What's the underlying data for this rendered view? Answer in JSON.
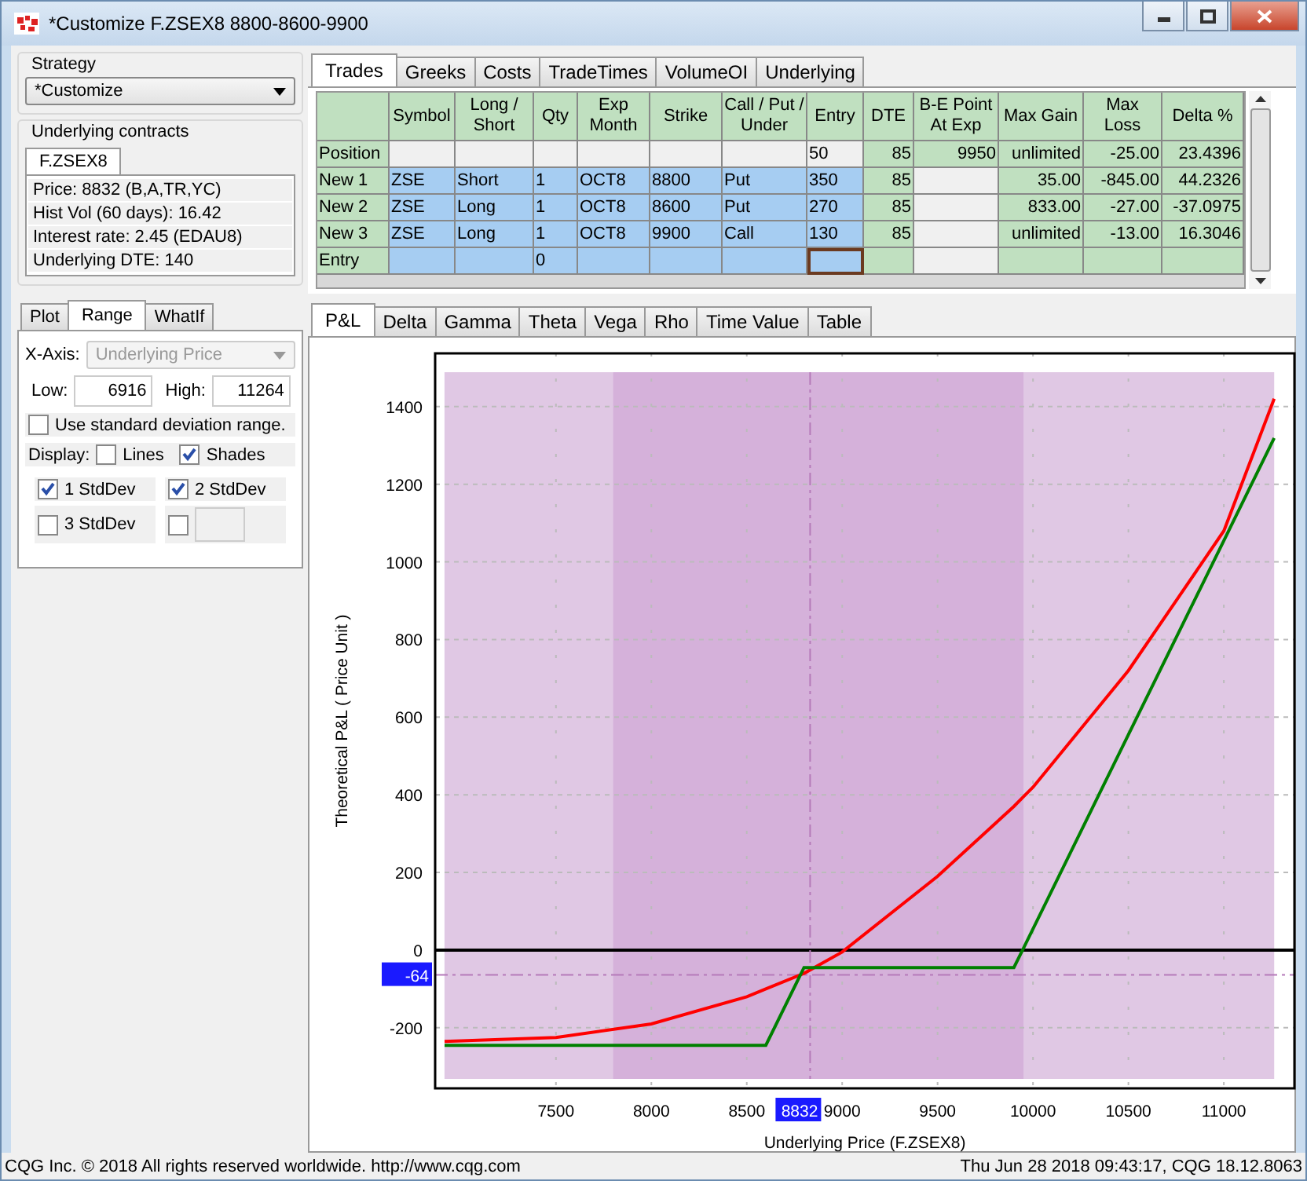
{
  "window": {
    "title": "*Customize F.ZSEX8 8800-8600-9900"
  },
  "strategy": {
    "label": "Strategy",
    "value": "*Customize"
  },
  "underlying": {
    "label": "Underlying contracts",
    "tab": "F.ZSEX8",
    "lines": [
      "Price: 8832 (B,A,TR,YC)",
      "Hist Vol (60 days): 16.42",
      "Interest rate: 2.45 (EDAU8)",
      "Underlying DTE: 140"
    ]
  },
  "settings_tabs": [
    {
      "label": "Plot",
      "selected": false
    },
    {
      "label": "Range",
      "selected": true
    },
    {
      "label": "WhatIf",
      "selected": false
    }
  ],
  "range": {
    "x_axis_label": "X-Axis:",
    "x_axis_value": "Underlying Price",
    "x_axis_disabled": true,
    "low_label": "Low:",
    "low": "6916",
    "high_label": "High:",
    "high": "11264",
    "std_range": {
      "label": "Use standard deviation range.",
      "checked": false
    },
    "display_label": "Display:",
    "display": [
      {
        "label": "Lines",
        "checked": false
      },
      {
        "label": "Shades",
        "checked": true
      }
    ],
    "stddevs": [
      {
        "label": "1 StdDev",
        "checked": true
      },
      {
        "label": "2 StdDev",
        "checked": true
      },
      {
        "label": "3 StdDev",
        "checked": false
      },
      {
        "checked": false,
        "swatch": true
      }
    ]
  },
  "trade_tabs": [
    {
      "label": "Trades",
      "selected": true
    },
    {
      "label": "Greeks",
      "selected": false
    },
    {
      "label": "Costs",
      "selected": false
    },
    {
      "label": "TradeTimes",
      "selected": false
    },
    {
      "label": "VolumeOI",
      "selected": false
    },
    {
      "label": "Underlying",
      "selected": false
    }
  ],
  "table": {
    "columns": [
      null,
      "Symbol",
      "Long / Short",
      "Qty",
      "Exp Month",
      "Strike",
      "Call / Put / Under",
      "Entry",
      "DTE",
      "B-E Point At Exp",
      "Max Gain",
      "Max Loss",
      "Delta %"
    ],
    "rows": [
      {
        "kind": "position",
        "cells": [
          "Position",
          null,
          null,
          null,
          null,
          null,
          null,
          "50",
          "85",
          "9950",
          "unlimited",
          "-25.00",
          "23.4396"
        ]
      },
      {
        "kind": "new",
        "cells": [
          "New 1",
          "ZSE",
          "Short",
          "1",
          "OCT8",
          "8800",
          "Put",
          "350",
          "85",
          null,
          "35.00",
          "-845.00",
          "44.2326"
        ]
      },
      {
        "kind": "new",
        "cells": [
          "New 2",
          "ZSE",
          "Long",
          "1",
          "OCT8",
          "8600",
          "Put",
          "270",
          "85",
          null,
          "833.00",
          "-27.00",
          "-37.0975"
        ]
      },
      {
        "kind": "new",
        "cells": [
          "New 3",
          "ZSE",
          "Long",
          "1",
          "OCT8",
          "9900",
          "Call",
          "130",
          "85",
          null,
          "unlimited",
          "-13.00",
          "16.3046"
        ]
      },
      {
        "kind": "entry",
        "cells": [
          "Entry",
          null,
          null,
          "0",
          null,
          null,
          null,
          null,
          null,
          null,
          null,
          null,
          null
        ]
      }
    ]
  },
  "chart_tabs": [
    {
      "label": "P&L",
      "selected": true
    },
    {
      "label": "Delta",
      "selected": false
    },
    {
      "label": "Gamma",
      "selected": false
    },
    {
      "label": "Theta",
      "selected": false
    },
    {
      "label": "Vega",
      "selected": false
    },
    {
      "label": "Rho",
      "selected": false
    },
    {
      "label": "Time Value",
      "selected": false
    },
    {
      "label": "Table",
      "selected": false
    }
  ],
  "chart": {
    "chart_data": {
      "type": "line",
      "xlabel": "Underlying Price (F.ZSEX8)",
      "ylabel": "Theoretical P&L ( Price Unit )",
      "x": [
        6916,
        7500,
        8000,
        8500,
        8600,
        8800,
        9000,
        9500,
        9900,
        9950,
        10000,
        10500,
        11000,
        11264
      ],
      "series": [
        {
          "color": "#ff0000",
          "values": [
            -235,
            -225,
            -190,
            -120,
            -100,
            -60,
            -5,
            190,
            370,
            395,
            420,
            720,
            1080,
            1420
          ]
        },
        {
          "color": "#008000",
          "values": [
            -245,
            -245,
            -245,
            -245,
            -245,
            -45,
            -45,
            -45,
            -45,
            5,
            55,
            555,
            1055,
            1319
          ]
        }
      ],
      "xlim": [
        6867,
        11370
      ],
      "ylim": [
        -356,
        1537
      ],
      "xticks": [
        7500,
        8000,
        8500,
        9000,
        9500,
        10000,
        10500,
        11000
      ],
      "yticks": [
        -200,
        0,
        200,
        400,
        600,
        800,
        1000,
        1200,
        1400
      ],
      "grid": true,
      "ref_lines": [
        {
          "axis": "x",
          "value": 8832,
          "label": "8832"
        },
        {
          "axis": "y",
          "value": -64,
          "label": "-64"
        }
      ]
    }
  },
  "status_bar": {
    "left": "CQG Inc. © 2018 All rights reserved worldwide. http://www.cqg.com",
    "right": "Thu Jun 28 2018 09:43:17, CQG 18.12.8063"
  }
}
